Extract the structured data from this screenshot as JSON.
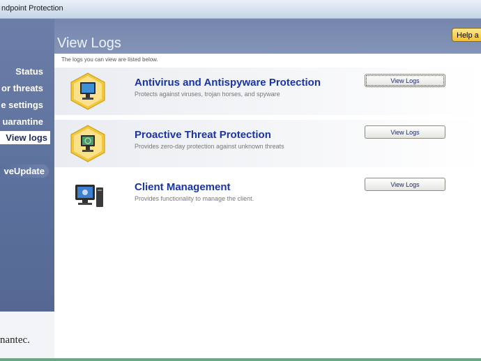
{
  "window": {
    "title": "ndpoint Protection"
  },
  "nav": {
    "items": [
      {
        "label": "Status"
      },
      {
        "label": "or threats"
      },
      {
        "label": "e settings"
      },
      {
        "label": "uarantine"
      },
      {
        "label": "View logs"
      },
      {
        "label": "veUpdate"
      }
    ],
    "brand": "nantec."
  },
  "header": {
    "title": "View Logs",
    "help_label": "Help a"
  },
  "main": {
    "intro": "The logs you can view are listed below.",
    "rows": [
      {
        "heading": "Antivirus and Antispyware Protection",
        "description": "Protects against viruses, trojan horses, and spyware",
        "button": "View Logs",
        "icon": "monitor-shield-icon"
      },
      {
        "heading": "Proactive Threat Protection",
        "description": "Provides zero-day protection against unknown threats",
        "button": "View Logs",
        "icon": "monitor-radar-icon"
      },
      {
        "heading": "Client Management",
        "description": "Provides functionality to manage the client.",
        "button": "View Logs",
        "icon": "computer-icon"
      }
    ]
  },
  "colors": {
    "nav_bg": "#5b6f9c",
    "heading": "#1933a8",
    "help_button": "#f0c036"
  }
}
